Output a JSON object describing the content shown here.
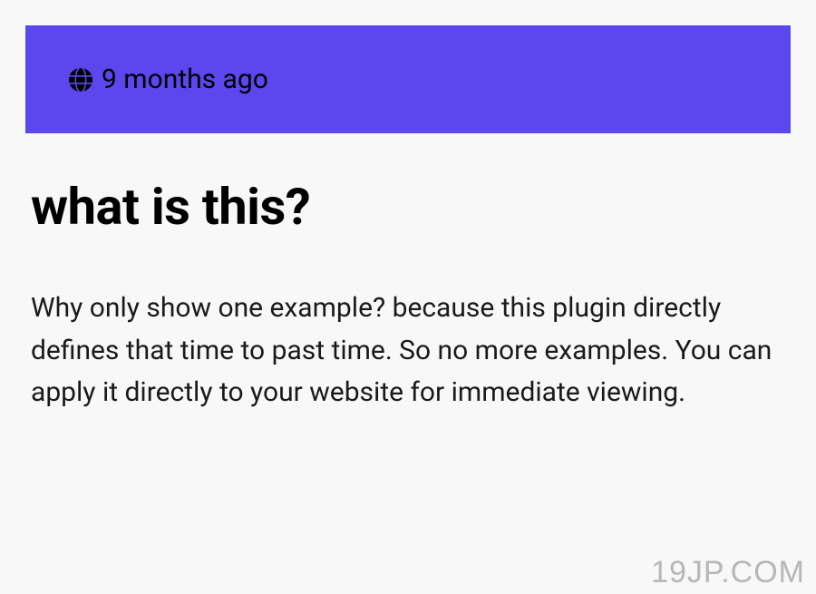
{
  "banner": {
    "timestamp": "9 months ago"
  },
  "content": {
    "heading": "what is this?",
    "body": "Why only show one example? because this plugin directly defines that time to past time. So no more examples. You can apply it directly to your website for immediate viewing."
  },
  "watermark": "19JP.COM"
}
